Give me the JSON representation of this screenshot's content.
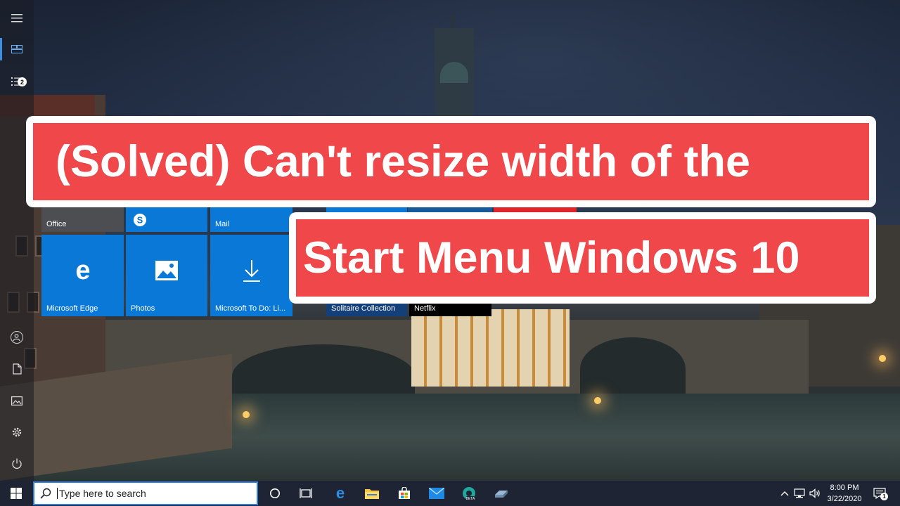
{
  "banner": {
    "line1": "(Solved) Can't resize width of the",
    "line2": "Start Menu Windows 10"
  },
  "rail": {
    "notification_badge": "2"
  },
  "tiles": {
    "office": "Office",
    "mail": "Mail",
    "edge": "Microsoft Edge",
    "photos": "Photos",
    "todo": "Microsoft To Do: Li...",
    "solitaire": "Solitaire Collection",
    "netflix": "Netflix"
  },
  "taskbar": {
    "search_placeholder": "Type here to search",
    "time": "8:00 PM",
    "date": "3/22/2020",
    "notification_count": "1"
  },
  "colors": {
    "banner_red": "#f0484a",
    "tile_blue": "#0a78d7",
    "accent": "#2d7fd8",
    "taskbar": "#1e2433"
  }
}
